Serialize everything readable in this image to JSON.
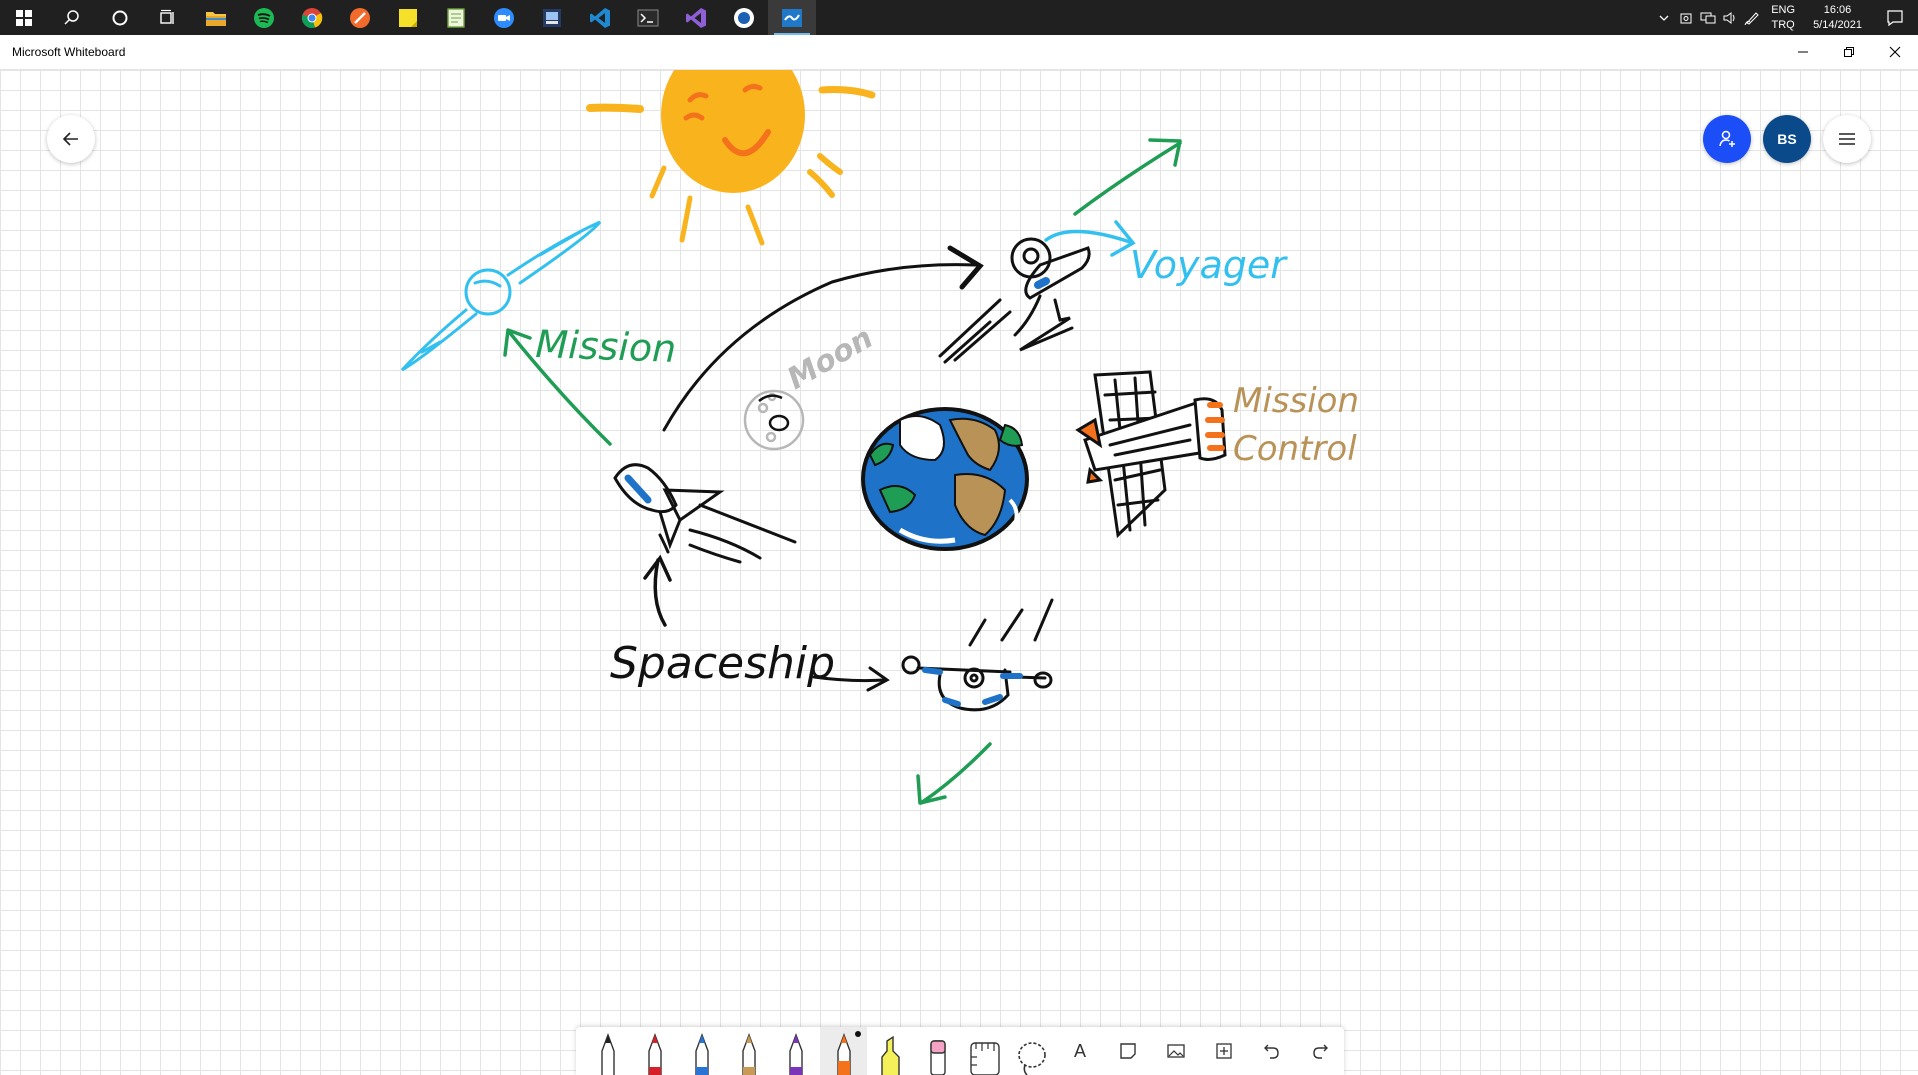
{
  "taskbar": {
    "items": [
      {
        "name": "start-button",
        "icon": "windows-logo-icon"
      },
      {
        "name": "search-button",
        "icon": "search-icon"
      },
      {
        "name": "cortana-button",
        "icon": "cortana-icon"
      },
      {
        "name": "task-view-button",
        "icon": "task-view-icon"
      },
      {
        "name": "file-explorer",
        "icon": "folder-icon"
      },
      {
        "name": "spotify",
        "icon": "spotify-icon"
      },
      {
        "name": "chrome",
        "icon": "chrome-icon"
      },
      {
        "name": "app-orange",
        "icon": "orange-app-icon"
      },
      {
        "name": "sticky-notes",
        "icon": "sticky-notes-icon"
      },
      {
        "name": "notepad-app",
        "icon": "notepad-icon"
      },
      {
        "name": "zoom",
        "icon": "zoom-icon"
      },
      {
        "name": "app-dark",
        "icon": "blue-app-icon"
      },
      {
        "name": "vscode",
        "icon": "vscode-icon"
      },
      {
        "name": "terminal",
        "icon": "terminal-icon"
      },
      {
        "name": "visual-studio",
        "icon": "visual-studio-icon"
      },
      {
        "name": "app-circle",
        "icon": "circle-app-icon"
      },
      {
        "name": "whiteboard",
        "icon": "whiteboard-icon",
        "active": true
      }
    ],
    "tray": {
      "lang_top": "ENG",
      "lang_bottom": "TRQ",
      "time": "16:06",
      "date": "5/14/2021"
    }
  },
  "window": {
    "title": "Microsoft Whiteboard"
  },
  "canvas": {
    "avatar_initials": "BS",
    "labels": {
      "mission": "Mission",
      "voyager": "Voyager",
      "moon": "Moon",
      "mission_control_line1": "Mission",
      "mission_control_line2": "Control",
      "spaceship": "Spaceship"
    },
    "colors": {
      "green": "#1f9d55",
      "light_blue": "#33c0ef",
      "black": "#111111",
      "sun": "#f9b31c",
      "orange": "#f4721c",
      "tan": "#b99258",
      "grey": "#b7b7b7",
      "blue": "#1e73c8",
      "accent": "#1b4ef7"
    }
  },
  "toolbar": {
    "tools": [
      {
        "name": "pen-black",
        "icon": "pen-icon",
        "color": "#222222"
      },
      {
        "name": "pen-red",
        "icon": "pen-icon",
        "color": "#d6202a"
      },
      {
        "name": "pen-blue",
        "icon": "pen-icon",
        "color": "#2a74d6"
      },
      {
        "name": "pen-tan",
        "icon": "pen-icon",
        "color": "#c99a55"
      },
      {
        "name": "pen-purple",
        "icon": "pen-icon",
        "color": "#7a35b8"
      },
      {
        "name": "pen-orange",
        "icon": "pen-icon",
        "color": "#f4721c",
        "selected": true
      },
      {
        "name": "highlighter-yellow",
        "icon": "highlighter-icon",
        "color": "#f4f05a"
      },
      {
        "name": "eraser",
        "icon": "eraser-icon",
        "color": "#f4a3c4"
      },
      {
        "name": "ruler",
        "icon": "ruler-icon"
      },
      {
        "name": "lasso",
        "icon": "lasso-icon"
      },
      {
        "name": "text",
        "icon": "text-icon",
        "label": "A"
      },
      {
        "name": "sticky-note",
        "icon": "note-icon"
      },
      {
        "name": "image",
        "icon": "image-icon"
      },
      {
        "name": "add",
        "icon": "add-icon"
      },
      {
        "name": "undo",
        "icon": "undo-icon"
      },
      {
        "name": "redo",
        "icon": "redo-icon"
      }
    ]
  }
}
